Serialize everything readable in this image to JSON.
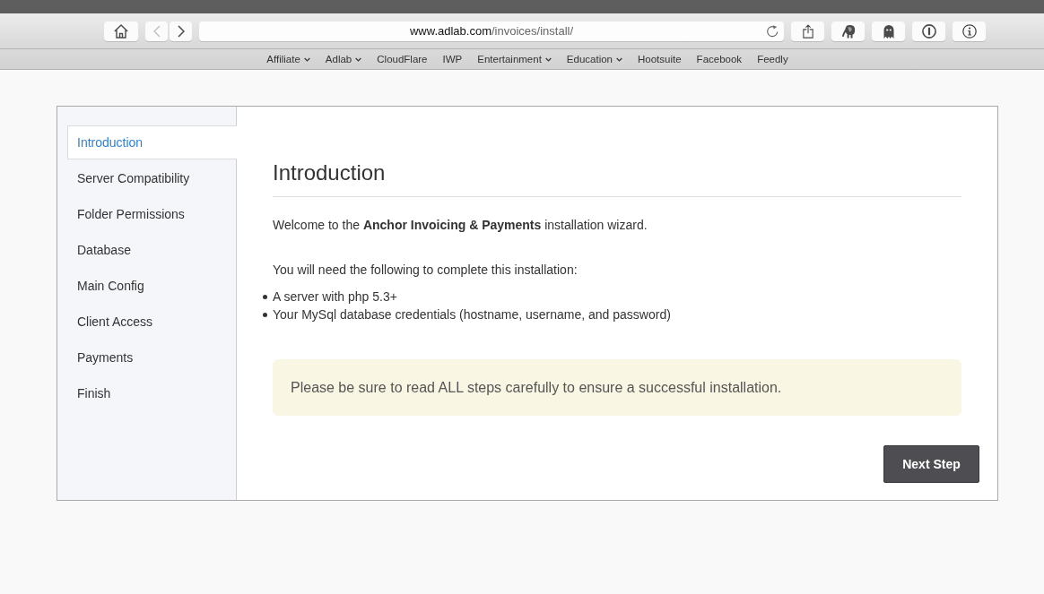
{
  "browser": {
    "back": {
      "disabled": true
    },
    "forward": {
      "disabled": false
    },
    "url": {
      "host": "www.adlab.com",
      "path": "/invoices/install/"
    },
    "bookmarks": [
      {
        "label": "Affiliate",
        "dropdown": true
      },
      {
        "label": "Adlab",
        "dropdown": true
      },
      {
        "label": "CloudFlare",
        "dropdown": false
      },
      {
        "label": "IWP",
        "dropdown": false
      },
      {
        "label": "Entertainment",
        "dropdown": true
      },
      {
        "label": "Education",
        "dropdown": true
      },
      {
        "label": "Hootsuite",
        "dropdown": false
      },
      {
        "label": "Facebook",
        "dropdown": false
      },
      {
        "label": "Feedly",
        "dropdown": false
      }
    ]
  },
  "sidebar": {
    "items": [
      {
        "label": "Introduction",
        "selected": true
      },
      {
        "label": "Server Compatibility",
        "selected": false
      },
      {
        "label": "Folder Permissions",
        "selected": false
      },
      {
        "label": "Database",
        "selected": false
      },
      {
        "label": "Main Config",
        "selected": false
      },
      {
        "label": "Client Access",
        "selected": false
      },
      {
        "label": "Payments",
        "selected": false
      },
      {
        "label": "Finish",
        "selected": false
      }
    ]
  },
  "content": {
    "title": "Introduction",
    "intro": "Welcome to the **Anchor Invoicing & Payments** installation wizard.",
    "requirements_heading": "You will need the following to complete this installation:",
    "requirements": [
      "A server with php 5.3+",
      "Your MySql database credentials (hostname, username, and password)"
    ],
    "notice": "Please be sure to read ALL steps carefully to ensure a successful installation.",
    "next_button": "Next Step"
  }
}
